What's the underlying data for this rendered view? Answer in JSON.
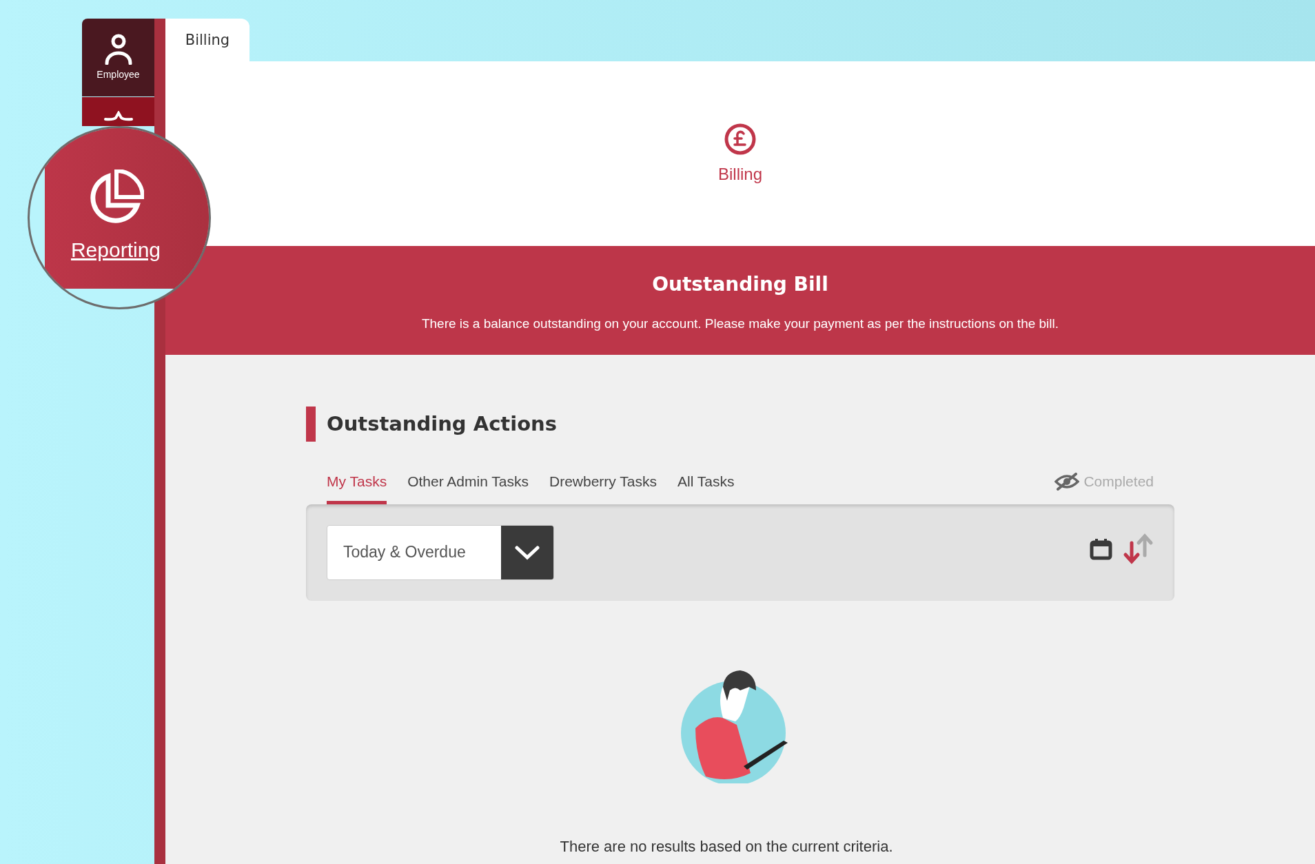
{
  "sidebar": {
    "items": [
      {
        "label": "Employee",
        "kind": "employee"
      }
    ]
  },
  "magnifier": {
    "label": "Reporting"
  },
  "page_tab": {
    "label": "Billing"
  },
  "header": {
    "label": "Billing"
  },
  "banner": {
    "title": "Outstanding Bill",
    "message": "There is a balance outstanding on your account. Please make your payment as per the instructions on the bill."
  },
  "actions": {
    "title": "Outstanding Actions",
    "tabs": [
      {
        "label": "My Tasks",
        "selected": true
      },
      {
        "label": "Other Admin Tasks",
        "selected": false
      },
      {
        "label": "Drewberry Tasks",
        "selected": false
      },
      {
        "label": "All Tasks",
        "selected": false
      }
    ],
    "completed_toggle": {
      "label": "Completed",
      "on": false
    }
  },
  "filter": {
    "value": "Today & Overdue"
  },
  "empty_message": "There are no results based on the current criteria."
}
